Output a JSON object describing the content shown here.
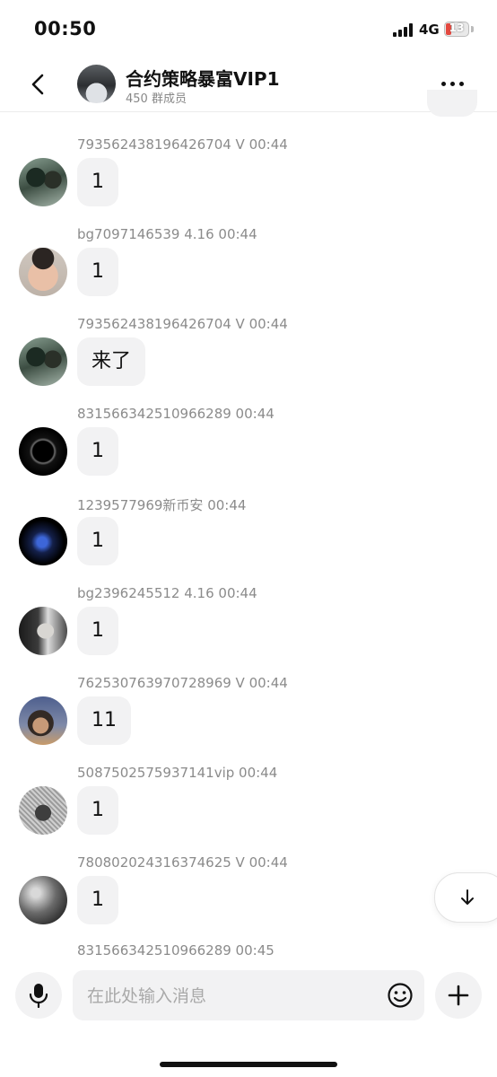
{
  "status_bar": {
    "time": "00:50",
    "network": "4G",
    "battery": "13"
  },
  "header": {
    "title": "合约策略暴富VIP1",
    "subtitle": "450 群成员"
  },
  "messages": [
    {
      "sender": "793562438196426704 V 00:44",
      "text": "1"
    },
    {
      "sender": "bg7097146539 4.16 00:44",
      "text": "1"
    },
    {
      "sender": "793562438196426704 V 00:44",
      "text": "来了"
    },
    {
      "sender": "831566342510966289 00:44",
      "text": "1"
    },
    {
      "sender": "1239577969新币安 00:44",
      "text": "1"
    },
    {
      "sender": "bg2396245512 4.16 00:44",
      "text": "1"
    },
    {
      "sender": "762530763970728969 V 00:44",
      "text": "11"
    },
    {
      "sender": "5087502575937141vip 00:44",
      "text": "1"
    },
    {
      "sender": "780802024316374625 V 00:44",
      "text": "1"
    },
    {
      "sender": "831566342510966289 00:45"
    }
  ],
  "input": {
    "placeholder": "在此处输入消息",
    "value": ""
  },
  "colors": {
    "bubble_bg": "#f2f2f3",
    "meta_text": "#8b8b8b",
    "battery_low": "#e5483f"
  },
  "icons": [
    "chevron-left-icon",
    "more-horizontal-icon",
    "arrow-down-icon",
    "microphone-icon",
    "smiley-icon",
    "plus-icon"
  ]
}
